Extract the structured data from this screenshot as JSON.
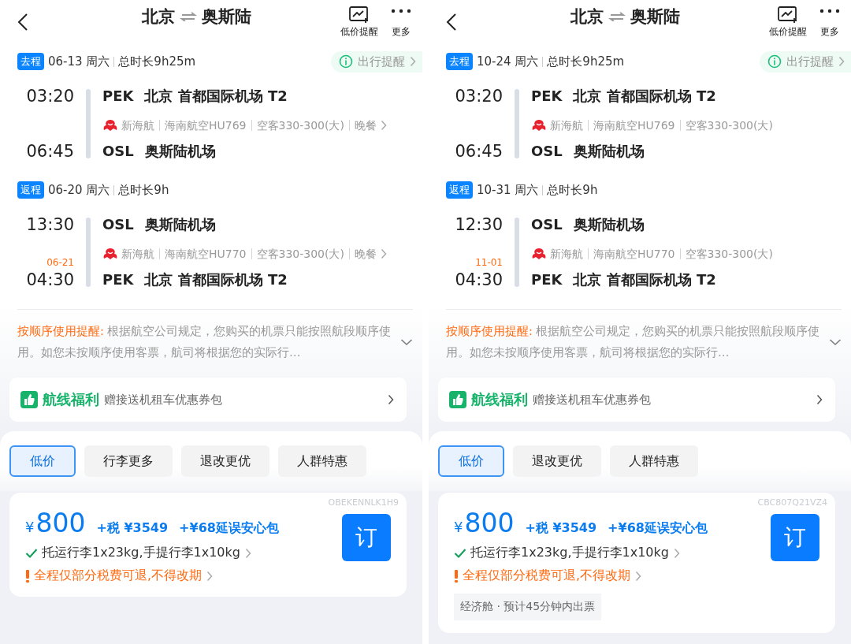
{
  "screens": [
    {
      "header": {
        "from": "北京",
        "to": "奥斯陆",
        "actions": [
          {
            "kind": "alert",
            "label": "低价提醒"
          },
          {
            "kind": "more",
            "label": "更多"
          }
        ]
      },
      "legs": [
        {
          "tag": "去程",
          "date": "06-13 周六",
          "duration": "总时长9h25m",
          "tip": "出行提醒",
          "departure": {
            "time": "03:20",
            "code": "PEK",
            "airport": "北京 首都国际机场 T2"
          },
          "arrival": {
            "time": "06:45",
            "code": "OSL",
            "airport": "奥斯陆机场"
          },
          "flight": {
            "airline": "新海航",
            "number": "海南航空HU769",
            "aircraft": "空客330-300(大)",
            "meal": "晚餐"
          }
        },
        {
          "tag": "返程",
          "date": "06-20 周六",
          "duration": "总时长9h",
          "departure": {
            "time": "13:30",
            "code": "OSL",
            "airport": "奥斯陆机场"
          },
          "arrival": {
            "time": "04:30",
            "date": "06-21",
            "code": "PEK",
            "airport": "北京 首都国际机场 T2"
          },
          "flight": {
            "airline": "新海航",
            "number": "海南航空HU770",
            "aircraft": "空客330-300(大)",
            "meal": "晚餐"
          }
        }
      ],
      "notice": {
        "label": "按顺序使用提醒:",
        "text": "根据航空公司规定，您购买的机票只能按照航段顺序使用。如您未按顺序使用客票，航司将根据您的实际行…"
      },
      "benefit": {
        "title": "航线福利",
        "text": "赠接送机租车优惠券包"
      },
      "filters": [
        {
          "label": "低价",
          "selected": true
        },
        {
          "label": "行李更多",
          "selected": false
        },
        {
          "label": "退改更优",
          "selected": false
        },
        {
          "label": "人群特惠",
          "selected": false
        }
      ],
      "offer": {
        "code": "OBEKENNLK1H9",
        "currency": "¥",
        "price": "800",
        "tax": "+税 ¥3549",
        "addon": "+¥68延误安心包",
        "book": "订",
        "baggage": "托运行李1x23kg,手提行李1x10kg",
        "refund": "全程仅部分税费可退,不得改期"
      }
    },
    {
      "header": {
        "from": "北京",
        "to": "奥斯陆",
        "actions": [
          {
            "kind": "alert",
            "label": "低价提醒"
          },
          {
            "kind": "more",
            "label": "更多"
          }
        ]
      },
      "legs": [
        {
          "tag": "去程",
          "date": "10-24 周六",
          "duration": "总时长9h25m",
          "tip": "出行提醒",
          "departure": {
            "time": "03:20",
            "code": "PEK",
            "airport": "北京 首都国际机场 T2"
          },
          "arrival": {
            "time": "06:45",
            "code": "OSL",
            "airport": "奥斯陆机场"
          },
          "flight": {
            "airline": "新海航",
            "number": "海南航空HU769",
            "aircraft": "空客330-300(大)"
          }
        },
        {
          "tag": "返程",
          "date": "10-31 周六",
          "duration": "总时长9h",
          "departure": {
            "time": "12:30",
            "code": "OSL",
            "airport": "奥斯陆机场"
          },
          "arrival": {
            "time": "04:30",
            "date": "11-01",
            "code": "PEK",
            "airport": "北京 首都国际机场 T2"
          },
          "flight": {
            "airline": "新海航",
            "number": "海南航空HU770",
            "aircraft": "空客330-300(大)"
          }
        }
      ],
      "notice": {
        "label": "按顺序使用提醒:",
        "text": "根据航空公司规定，您购买的机票只能按照航段顺序使用。如您未按顺序使用客票，航司将根据您的实际行…"
      },
      "benefit": {
        "title": "航线福利",
        "text": "赠接送机租车优惠券包"
      },
      "filters": [
        {
          "label": "低价",
          "selected": true
        },
        {
          "label": "退改更优",
          "selected": false
        },
        {
          "label": "人群特惠",
          "selected": false
        }
      ],
      "offer": {
        "code": "CBC807Q21VZ4",
        "currency": "¥",
        "price": "800",
        "tax": "+税 ¥3549",
        "addon": "+¥68延误安心包",
        "book": "订",
        "baggage": "托运行李1x23kg,手提行李1x10kg",
        "refund": "全程仅部分税费可退,不得改期",
        "cabin": "经济舱 · 预计45分钟内出票"
      }
    }
  ]
}
